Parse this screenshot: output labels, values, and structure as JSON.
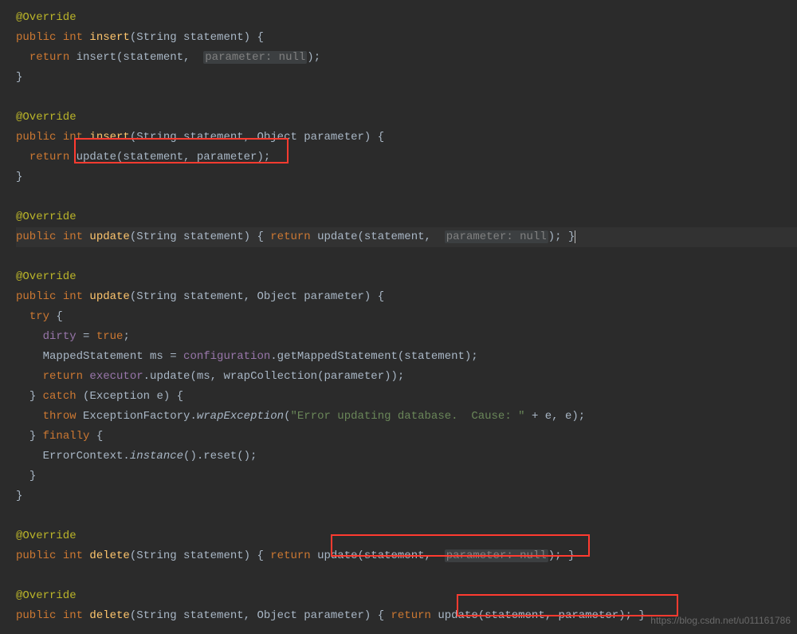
{
  "watermark": "https://blog.csdn.net/u011161786",
  "hints": {
    "param_null": "parameter: null"
  },
  "code": {
    "l1": {
      "ann": "@Override"
    },
    "l2": {
      "kw1": "public ",
      "kw2": "int ",
      "m": "insert",
      "sig": "(String statement) {"
    },
    "l3": {
      "kw": "return ",
      "call": "insert(statement,  ",
      "hint": "parameter: null",
      "end": ");"
    },
    "l4": {
      "t": "}"
    },
    "l5": {
      "ann": "@Override"
    },
    "l6": {
      "kw1": "public ",
      "kw2": "int ",
      "m": "insert",
      "sig": "(String statement, Object parameter) {"
    },
    "l7": {
      "kw": "return ",
      "call": "update(statement, parameter);"
    },
    "l8": {
      "t": "}"
    },
    "l9": {
      "ann": "@Override"
    },
    "l10": {
      "kw1": "public ",
      "kw2": "int ",
      "m": "update",
      "sig": "(String statement) { ",
      "kw3": "return ",
      "call": "update(statement,  ",
      "hint": "parameter: null",
      "end": "); }"
    },
    "l11": {
      "ann": "@Override"
    },
    "l12": {
      "kw1": "public ",
      "kw2": "int ",
      "m": "update",
      "sig": "(String statement, Object parameter) {"
    },
    "l13": {
      "kw": "try ",
      "t": "{"
    },
    "l14": {
      "f": "dirty",
      "t": " = ",
      "kw": "true",
      "end": ";"
    },
    "l15": {
      "t1": "MappedStatement ms = ",
      "f": "configuration",
      "t2": ".getMappedStatement(statement);"
    },
    "l16": {
      "kw": "return ",
      "f": "executor",
      "t": ".update(ms, wrapCollection(parameter));"
    },
    "l17": {
      "t": "} ",
      "kw": "catch ",
      "t2": "(Exception e) {"
    },
    "l18": {
      "kw": "throw ",
      "t": "ExceptionFactory.",
      "m": "wrapException",
      "t2": "(",
      "s": "\"Error updating database.  Cause: \"",
      "t3": " + e, e);"
    },
    "l19": {
      "t": "} ",
      "kw": "finally ",
      "t2": "{"
    },
    "l20": {
      "t": "ErrorContext.",
      "m": "instance",
      "t2": "().reset();"
    },
    "l21": {
      "t": "}"
    },
    "l22": {
      "t": "}"
    },
    "l23": {
      "ann": "@Override"
    },
    "l24": {
      "kw1": "public ",
      "kw2": "int ",
      "m": "delete",
      "sig": "(String statement) { ",
      "kw3": "return ",
      "call": "update(statement,  ",
      "hint": "parameter: null",
      "end": "); }"
    },
    "l25": {
      "ann": "@Override"
    },
    "l26": {
      "kw1": "public ",
      "kw2": "int ",
      "m": "delete",
      "sig": "(String statement, Object parameter) { ",
      "kw3": "return ",
      "call": "update(statement, parameter);",
      "end": " }"
    }
  }
}
